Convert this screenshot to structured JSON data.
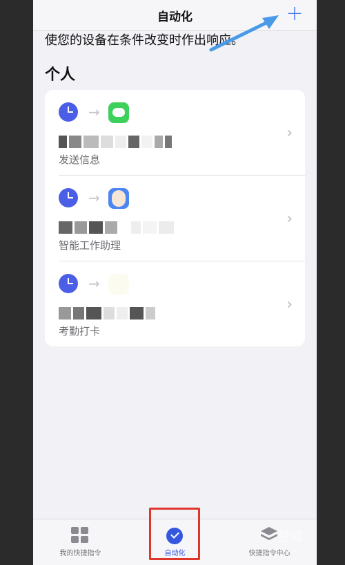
{
  "nav": {
    "title": "自动化",
    "add_label": "+"
  },
  "subtitle": "使您的设备在条件改变时作出响应。",
  "section_title": "个人",
  "automations": [
    {
      "trigger_icon": "clock-icon",
      "app_icon": "messages-icon",
      "description": "发送信息",
      "name_redacted": true
    },
    {
      "trigger_icon": "clock-icon",
      "app_icon": "work-assistant-icon",
      "description": "智能工作助理",
      "name_redacted": true
    },
    {
      "trigger_icon": "clock-icon",
      "app_icon": "attendance-icon",
      "description": "考勤打卡",
      "name_redacted": true
    }
  ],
  "tabs": [
    {
      "label": "我的快捷指令",
      "icon": "grid-icon",
      "active": false
    },
    {
      "label": "自动化",
      "icon": "automation-icon",
      "active": true
    },
    {
      "label": "快捷指令中心",
      "icon": "gallery-icon",
      "active": false
    }
  ],
  "watermark": "经验",
  "colors": {
    "accent": "#3557e0",
    "annotation_arrow": "#4a9ae8",
    "annotation_box": "#e0352b"
  }
}
